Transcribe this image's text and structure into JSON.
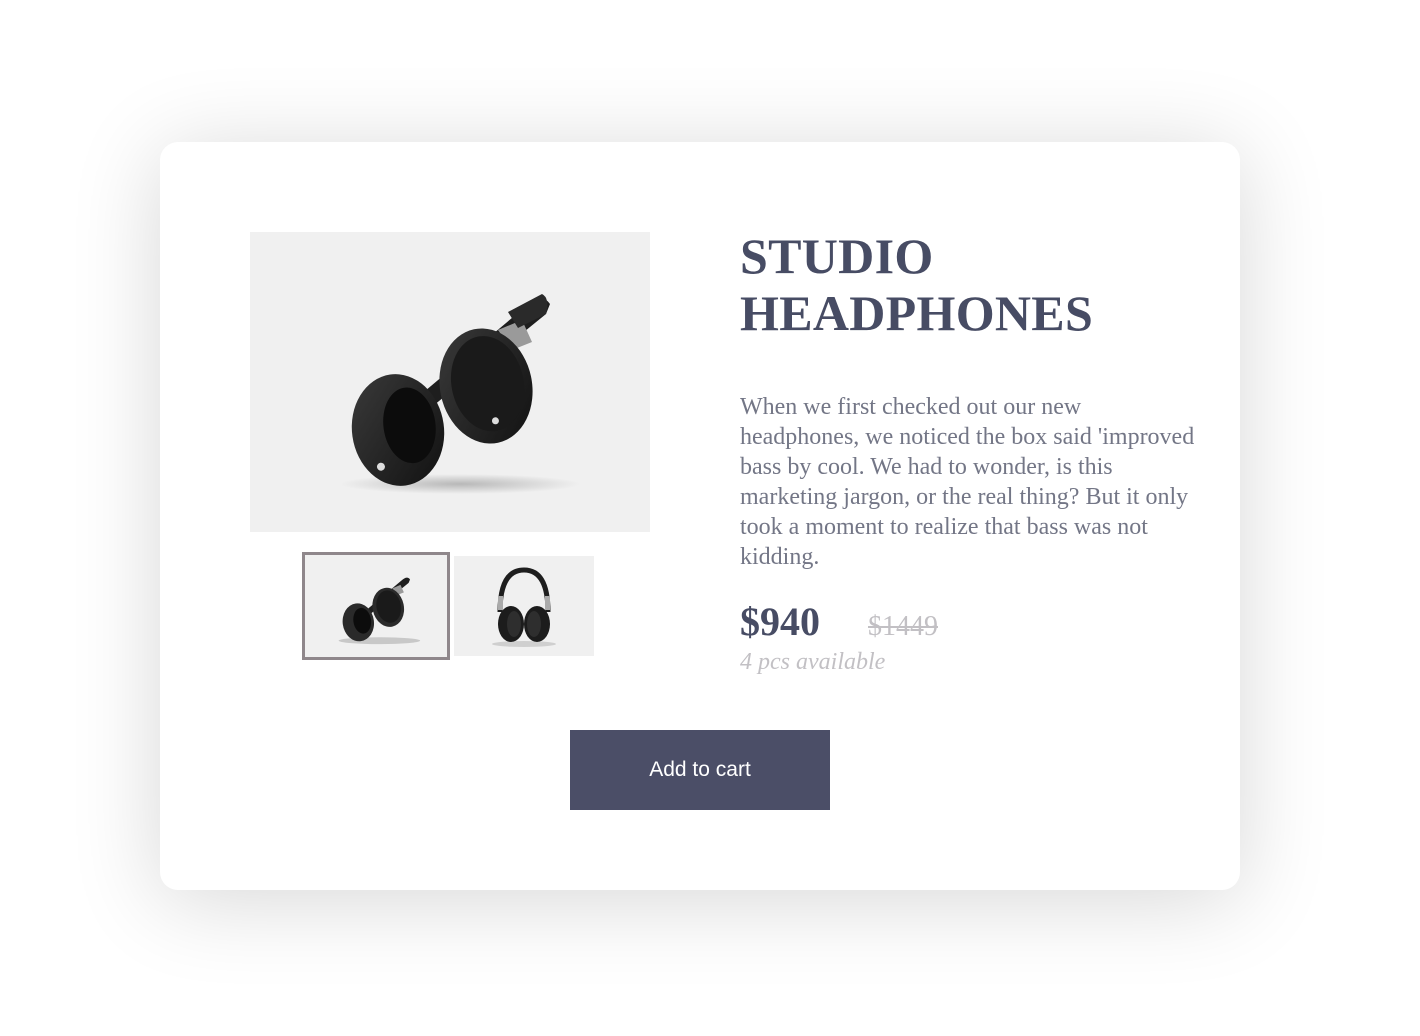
{
  "product": {
    "title_line1": "STUDIO",
    "title_line2": "HEADPHONES",
    "description": "When we first checked out our new headphones, we noticed the box said 'improved bass by cool. We had to wonder, is this marketing jargon, or the real thing? But it only took a moment to realize that bass was not kidding.",
    "price": "$940",
    "old_price": "$1449",
    "availability": "4 pcs available",
    "add_to_cart_label": "Add to cart"
  },
  "gallery": {
    "selected_index": 0,
    "images": [
      {
        "icon": "headphones-tilted-image"
      },
      {
        "icon": "headphones-front-image"
      }
    ]
  },
  "colors": {
    "title": "#474c64",
    "text": "#737686",
    "muted": "#c2c0c4",
    "button": "#4b4e67",
    "image_bg": "#f0f0f0",
    "thumb_border": "#8f878b"
  }
}
